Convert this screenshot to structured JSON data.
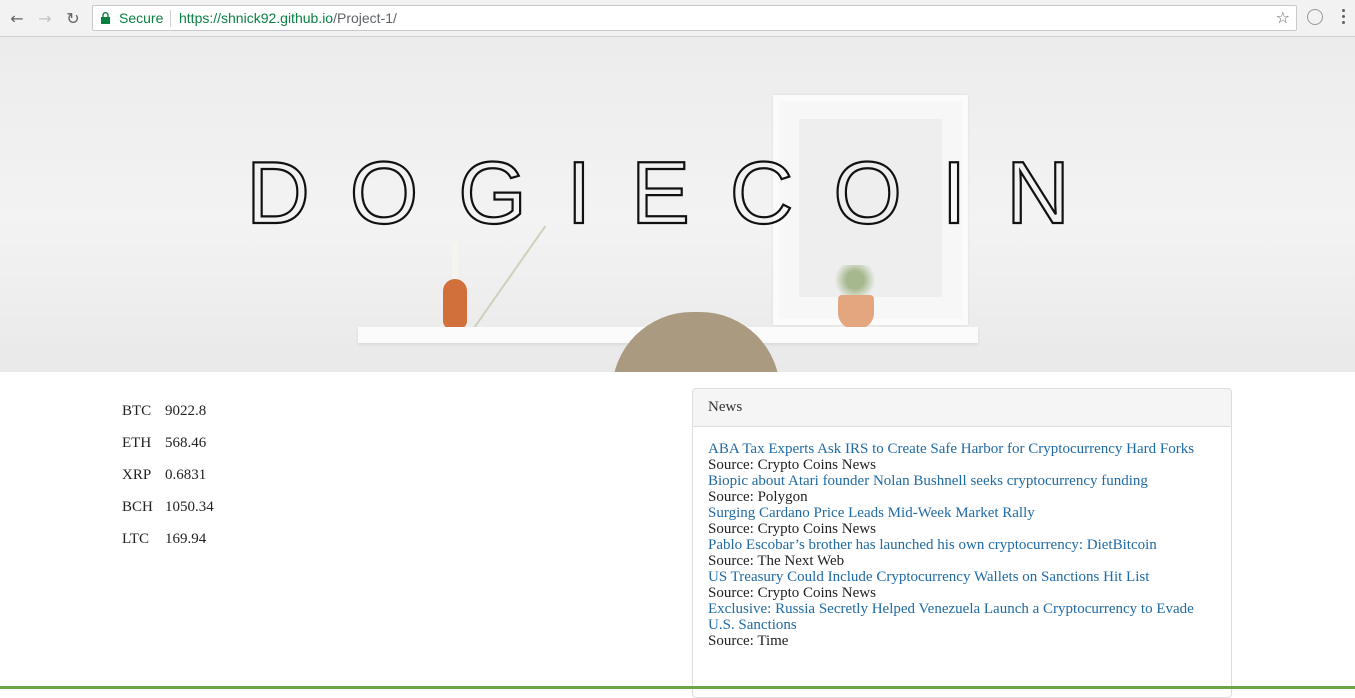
{
  "browser": {
    "secure_label": "Secure",
    "url_host": "https://shnick92.github.io",
    "url_path": "/Project-1/"
  },
  "hero": {
    "title": "DOGIECOIN"
  },
  "prices": [
    {
      "symbol": "BTC",
      "value": "9022.8"
    },
    {
      "symbol": "ETH",
      "value": "568.46"
    },
    {
      "symbol": "XRP",
      "value": "0.6831"
    },
    {
      "symbol": "BCH",
      "value": "1050.34"
    },
    {
      "symbol": "LTC",
      "value": "169.94"
    }
  ],
  "news": {
    "heading": "News",
    "source_prefix": "Source: ",
    "items": [
      {
        "title": "ABA Tax Experts Ask IRS to Create Safe Harbor for Cryptocurrency Hard Forks",
        "source": "Crypto Coins News"
      },
      {
        "title": "Biopic about Atari founder Nolan Bushnell seeks cryptocurrency funding",
        "source": "Polygon"
      },
      {
        "title": "Surging Cardano Price Leads Mid-Week Market Rally",
        "source": "Crypto Coins News"
      },
      {
        "title": "Pablo Escobar’s brother has launched his own cryptocurrency: DietBitcoin",
        "source": "The Next Web"
      },
      {
        "title": "US Treasury Could Include Cryptocurrency Wallets on Sanctions Hit List",
        "source": "Crypto Coins News"
      },
      {
        "title": "Exclusive: Russia Secretly Helped Venezuela Launch a Cryptocurrency to Evade U.S. Sanctions",
        "source": "Time"
      }
    ]
  },
  "colors": {
    "link": "#1f6aa5",
    "secure_green": "#0b8043",
    "bottom_accent": "#6aa546"
  }
}
